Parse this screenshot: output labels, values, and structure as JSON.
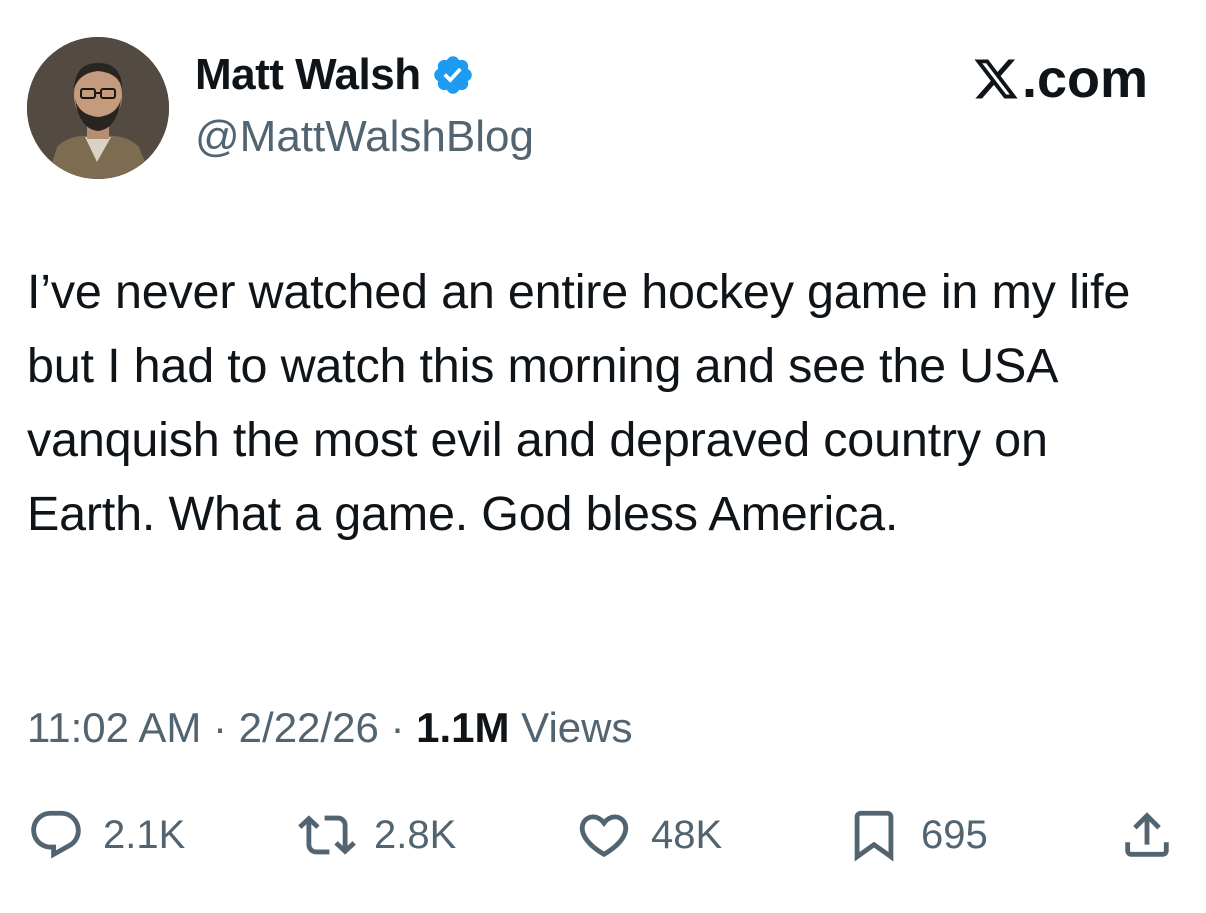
{
  "author": {
    "display_name": "Matt Walsh",
    "handle": "@MattWalshBlog",
    "verified": true
  },
  "brand": {
    "label": ".com"
  },
  "tweet": {
    "text": "I’ve never watched an entire hockey game in my life but I had to watch this morning and see the USA vanquish the most evil and depraved country on Earth. What a game. God bless America."
  },
  "meta": {
    "time": "11:02 AM",
    "date": "2/22/26",
    "separator": " · ",
    "views_count": "1.1M",
    "views_label": " Views"
  },
  "actions": {
    "replies": "2.1K",
    "reposts": "2.8K",
    "likes": "48K",
    "bookmarks": "695"
  },
  "colors": {
    "text_primary": "#0f1419",
    "text_secondary": "#536471",
    "verified_blue": "#1d9bf0"
  },
  "icons": [
    "reply-icon",
    "repost-icon",
    "like-icon",
    "bookmark-icon",
    "share-icon",
    "verified-badge-icon",
    "x-logo-icon"
  ]
}
